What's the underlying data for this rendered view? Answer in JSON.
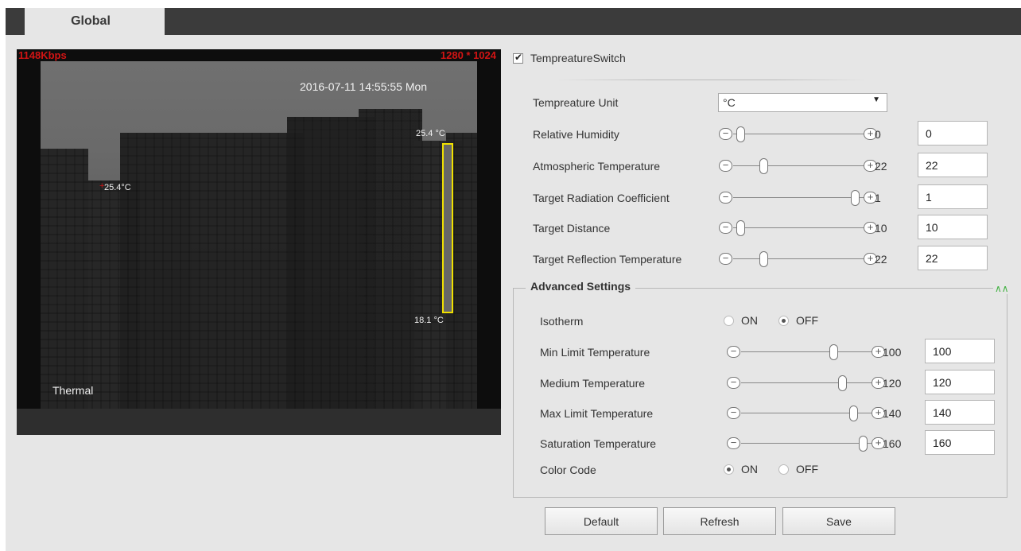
{
  "tabs": [
    {
      "label": "Global"
    }
  ],
  "video": {
    "bitrate": "1148Kbps",
    "resolution": "1280 * 1024",
    "timestamp": "2016-07-11 14:55:55 Mon",
    "max_temp": "25.4 °C",
    "min_temp": "18.1 °C",
    "spot_temp": "25.4°C",
    "channel": "Thermal"
  },
  "temperature_switch": {
    "label": "TempreatureSwitch",
    "checked": true
  },
  "unit": {
    "label": "Tempreature Unit",
    "value": "°C"
  },
  "settings": [
    {
      "label": "Relative Humidity",
      "value": "0",
      "input": "0",
      "fraction": 0.0
    },
    {
      "label": "Atmospheric Temperature",
      "value": "22",
      "input": "22",
      "fraction": 0.2
    },
    {
      "label": "Target Radiation Coefficient",
      "value": "1",
      "input": "1",
      "fraction": 1.0
    },
    {
      "label": "Target Distance",
      "value": "10",
      "input": "10",
      "fraction": 0.0
    },
    {
      "label": "Target Reflection Temperature",
      "value": "22",
      "input": "22",
      "fraction": 0.2
    }
  ],
  "advanced": {
    "title": "Advanced Settings",
    "isotherm": {
      "label": "Isotherm",
      "on": "ON",
      "off": "OFF",
      "selected": "OFF"
    },
    "items": [
      {
        "label": "Min Limit Temperature",
        "value": "100",
        "input": "100",
        "fraction": 0.74
      },
      {
        "label": "Medium Temperature",
        "value": "120",
        "input": "120",
        "fraction": 0.82
      },
      {
        "label": "Max Limit Temperature",
        "value": "140",
        "input": "140",
        "fraction": 0.92
      },
      {
        "label": "Saturation Temperature",
        "value": "160",
        "input": "160",
        "fraction": 1.0
      }
    ],
    "color_code": {
      "label": "Color Code",
      "on": "ON",
      "off": "OFF",
      "selected": "ON"
    }
  },
  "buttons": {
    "default": "Default",
    "refresh": "Refresh",
    "save": "Save"
  },
  "colors": {
    "tabbar": "#3b3b3b",
    "panel": "#e6e6e6",
    "osd_red": "#d21414",
    "temp_bar": "#f0e000",
    "collapse": "#44b244"
  }
}
